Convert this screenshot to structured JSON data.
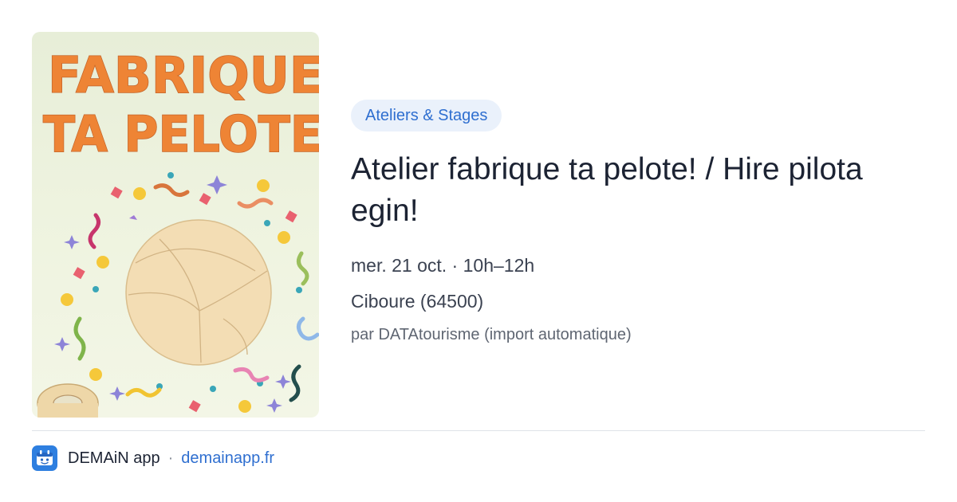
{
  "poster": {
    "line1": "FABRIQUE",
    "line2": "TA PELOTE",
    "icon": "pelota-ball-poster"
  },
  "event": {
    "category": "Ateliers & Stages",
    "title": "Atelier fabrique ta pelote! / Hire pilota egin!",
    "when": "mer. 21 oct. · 10h–12h",
    "where": "Ciboure (64500)",
    "source": "par DATAtourisme (import automatique)"
  },
  "footer": {
    "app_name": "DEMAiN app",
    "separator": "·",
    "url": "demainapp.fr",
    "icon": "demain-app-logo-icon"
  },
  "colors": {
    "accent": "#2f6fd0",
    "badge_bg": "#eaf1fb",
    "poster_title": "#ee8435",
    "ball": "#f3ddb4"
  }
}
